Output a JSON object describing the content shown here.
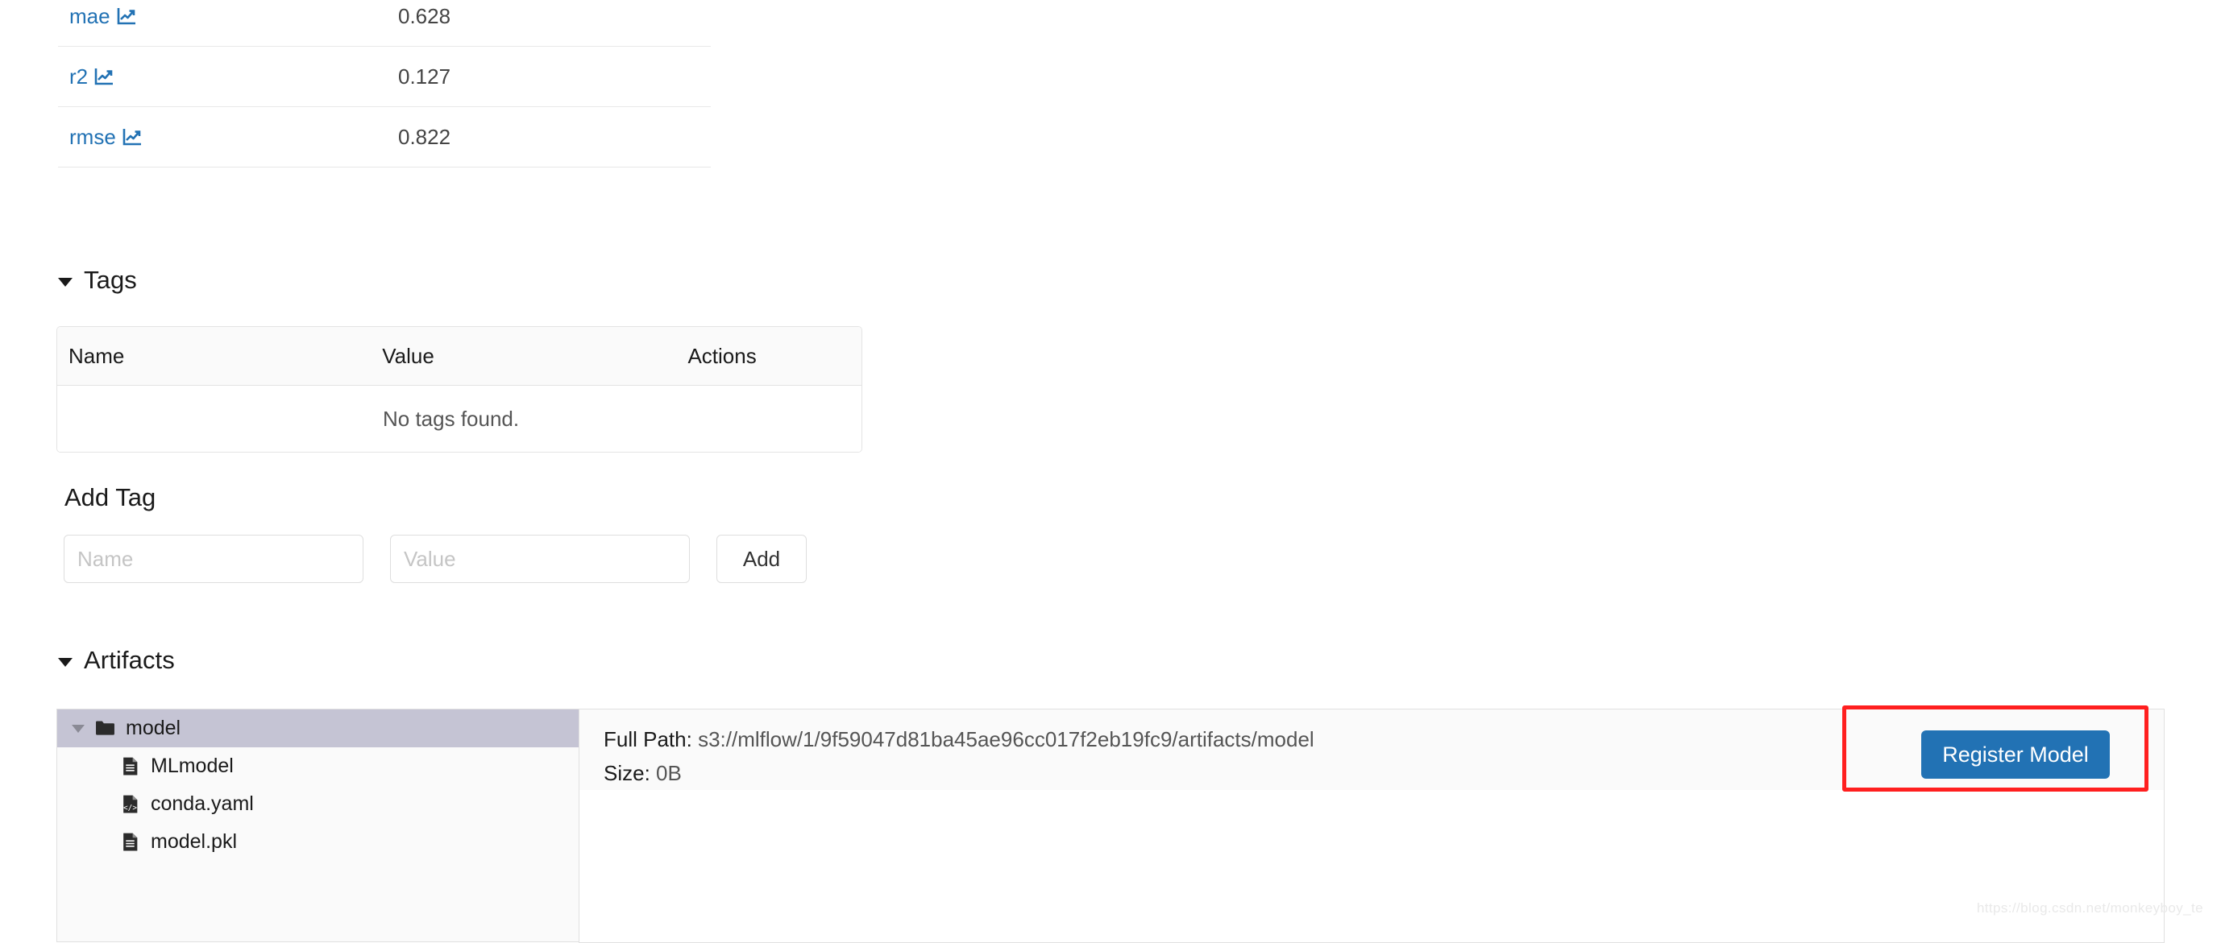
{
  "metrics": {
    "rows": [
      {
        "name": "mae",
        "value": "0.628",
        "icon": "line-chart-icon"
      },
      {
        "name": "r2",
        "value": "0.127",
        "icon": "line-chart-icon"
      },
      {
        "name": "rmse",
        "value": "0.822",
        "icon": "line-chart-icon"
      }
    ]
  },
  "tags": {
    "section_title": "Tags",
    "columns": {
      "name": "Name",
      "value": "Value",
      "actions": "Actions"
    },
    "empty_message": "No tags found.",
    "rows": []
  },
  "add_tag": {
    "label": "Add Tag",
    "name_placeholder": "Name",
    "name_value": "",
    "value_placeholder": "Value",
    "value_value": "",
    "add_label": "Add"
  },
  "artifacts": {
    "section_title": "Artifacts",
    "tree": [
      {
        "label": "model",
        "type": "folder",
        "icon": "folder-icon",
        "selected": true,
        "expanded": true,
        "depth": 0
      },
      {
        "label": "MLmodel",
        "type": "file",
        "icon": "document-icon",
        "selected": false,
        "depth": 1
      },
      {
        "label": "conda.yaml",
        "type": "file",
        "icon": "code-file-icon",
        "selected": false,
        "depth": 1
      },
      {
        "label": "model.pkl",
        "type": "file",
        "icon": "document-icon",
        "selected": false,
        "depth": 1
      }
    ],
    "detail": {
      "full_path_label": "Full Path:",
      "full_path_value": "s3://mlflow/1/9f59047d81ba45ae96cc017f2eb19fc9/artifacts/model",
      "size_label": "Size:",
      "size_value": "0B"
    },
    "register_label": "Register Model"
  },
  "annotation": {
    "highlight_color": "#ff1f1f"
  },
  "watermark": "https://blog.csdn.net/monkeyboy_te",
  "colors": {
    "link": "#2272b4",
    "primary_button": "#2272b4",
    "selected_row": "#c5c4d4"
  }
}
